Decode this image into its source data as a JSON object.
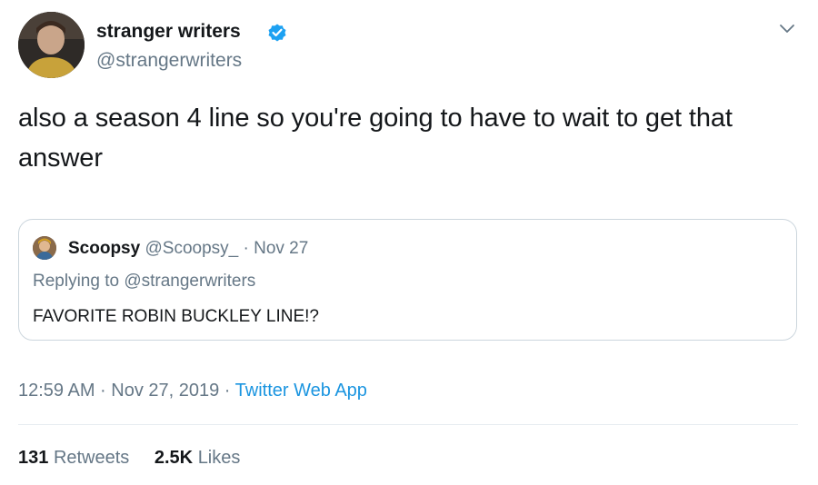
{
  "author": {
    "display_name": "stranger writers",
    "handle": "@strangerwriters",
    "verified": true,
    "avatar_icon": "profile-photo"
  },
  "tweet": {
    "text": "also a season 4 line so you're going to have to wait to get that answer"
  },
  "quoted_tweet": {
    "display_name": "Scoopsy",
    "meta": "@Scoopsy_ · Nov 27",
    "replying_to": "Replying to @strangerwriters",
    "text": "FAVORITE ROBIN BUCKLEY LINE!?"
  },
  "footer": {
    "time_date": "12:59 AM · Nov 27, 2019 · ",
    "source": "Twitter Web App"
  },
  "stats": {
    "retweets_count": "131",
    "retweets_label": "Retweets",
    "likes_count": "2.5K",
    "likes_label": "Likes"
  },
  "colors": {
    "link": "#1b95e0",
    "secondary_text": "#657786",
    "verified_badge": "#1da1f2"
  }
}
